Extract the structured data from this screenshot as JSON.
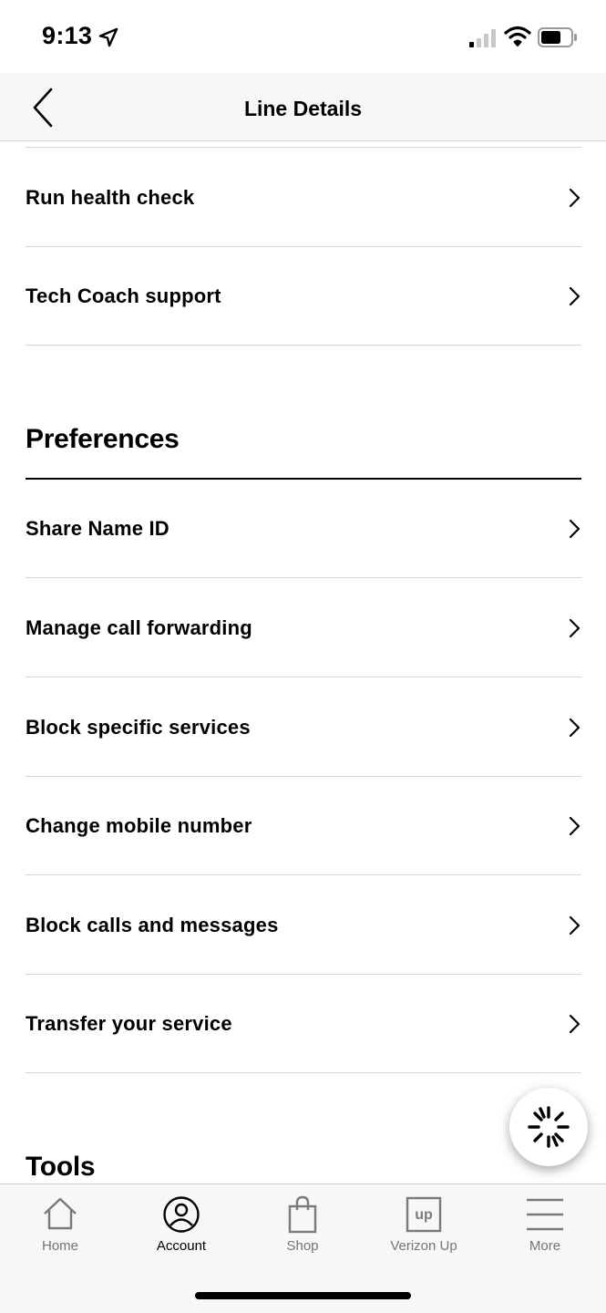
{
  "status_bar": {
    "time": "9:13"
  },
  "header": {
    "title": "Line Details",
    "back_icon": "chevron-left-icon"
  },
  "rows_top": [
    {
      "label": "Run health check"
    },
    {
      "label": "Tech Coach support"
    }
  ],
  "preferences": {
    "title": "Preferences",
    "items": [
      {
        "label": "Share Name ID"
      },
      {
        "label": "Manage call forwarding"
      },
      {
        "label": "Block specific services"
      },
      {
        "label": "Change mobile number"
      },
      {
        "label": "Block calls and messages"
      },
      {
        "label": "Transfer your service"
      }
    ]
  },
  "tools": {
    "title": "Tools"
  },
  "chat_button": {
    "icon": "chat-spark-icon"
  },
  "tab_bar": {
    "tabs": [
      {
        "label": "Home",
        "icon": "home-icon",
        "active": false
      },
      {
        "label": "Account",
        "icon": "account-icon",
        "active": true
      },
      {
        "label": "Shop",
        "icon": "shopping-bag-icon",
        "active": false
      },
      {
        "label": "Verizon Up",
        "icon": "verizon-up-icon",
        "active": false
      },
      {
        "label": "More",
        "icon": "menu-icon",
        "active": false
      }
    ]
  },
  "colors": {
    "text": "#000000",
    "header_bg": "#f7f7f7",
    "divider": "#d6d6d6",
    "inactive_tab": "#747474"
  }
}
